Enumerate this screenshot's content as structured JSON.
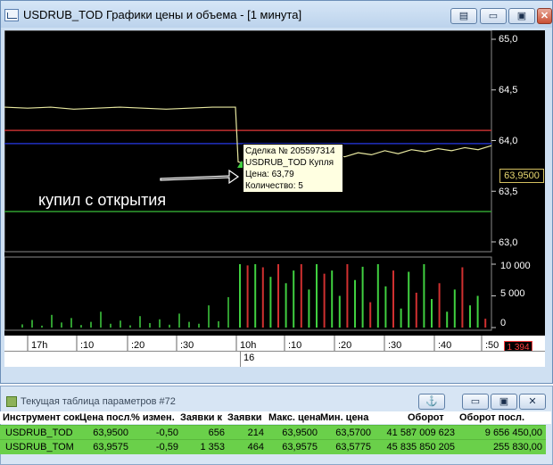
{
  "window": {
    "title": "USDRUB_TOD Графики цены и объема - [1 минута]",
    "buttons": {
      "menu": "▤",
      "minimize": "▭",
      "maximize": "▣",
      "close": "✕"
    }
  },
  "chart": {
    "y_ticks": [
      "65,0",
      "64,5",
      "64,0",
      "63,5",
      "63,0"
    ],
    "vol_ticks": [
      "10 000",
      "5 000",
      "0"
    ],
    "x_ticks": [
      "17h",
      ":10",
      ":20",
      ":30",
      "10h",
      ":10",
      ":20",
      ":30",
      ":40",
      ":50"
    ],
    "date_label": "16",
    "last_price_label": "63,9500",
    "last_volume_label": "1 394",
    "annotation": "купил с открытия",
    "tooltip": {
      "line1": "Сделка № 205597314",
      "line2": "USDRUB_TOD Купля",
      "line3": "Цена: 63,79",
      "line4": "Количество: 5"
    },
    "colors": {
      "price_line": "#e8e8a0",
      "red_level": "#c03030",
      "blue_level": "#2030c0",
      "green_level": "#30a030",
      "buy_vol": "#40d040",
      "sell_vol": "#d03030"
    }
  },
  "chart_data": {
    "type": "line",
    "title": "",
    "y_ticks": [
      65.0,
      64.5,
      64.0,
      63.5,
      63.0
    ],
    "ylim": [
      63.0,
      65.0
    ],
    "horizontal_levels": [
      64.1,
      63.97,
      63.3
    ],
    "price_series_before_open": [
      64.33,
      64.32,
      64.33,
      64.31,
      64.32,
      64.33,
      64.32,
      64.31,
      64.32,
      64.33,
      64.33
    ],
    "price_series_after_open": [
      63.79,
      63.75,
      63.78,
      63.8,
      63.82,
      63.85,
      63.83,
      63.86,
      63.84,
      63.88,
      63.86,
      63.9,
      63.87,
      63.91,
      63.89,
      63.92,
      63.9,
      63.93,
      63.91,
      63.95
    ],
    "volume_ticks": [
      10000,
      5000,
      0
    ],
    "volume_after_open": [
      {
        "v": 10000,
        "side": "buy"
      },
      {
        "v": 9800,
        "side": "sell"
      },
      {
        "v": 10000,
        "side": "buy"
      },
      {
        "v": 9500,
        "side": "sell"
      },
      {
        "v": 8000,
        "side": "buy"
      },
      {
        "v": 10000,
        "side": "sell"
      },
      {
        "v": 7000,
        "side": "buy"
      },
      {
        "v": 9000,
        "side": "buy"
      },
      {
        "v": 10000,
        "side": "sell"
      },
      {
        "v": 6000,
        "side": "buy"
      },
      {
        "v": 10000,
        "side": "buy"
      },
      {
        "v": 8500,
        "side": "sell"
      },
      {
        "v": 9000,
        "side": "buy"
      },
      {
        "v": 5000,
        "side": "buy"
      },
      {
        "v": 10000,
        "side": "sell"
      },
      {
        "v": 7500,
        "side": "buy"
      },
      {
        "v": 9600,
        "side": "buy"
      },
      {
        "v": 4000,
        "side": "sell"
      },
      {
        "v": 10000,
        "side": "buy"
      },
      {
        "v": 6500,
        "side": "buy"
      },
      {
        "v": 9000,
        "side": "sell"
      },
      {
        "v": 3000,
        "side": "buy"
      },
      {
        "v": 8800,
        "side": "buy"
      },
      {
        "v": 5500,
        "side": "sell"
      },
      {
        "v": 10000,
        "side": "buy"
      },
      {
        "v": 4500,
        "side": "buy"
      },
      {
        "v": 7000,
        "side": "sell"
      },
      {
        "v": 2500,
        "side": "buy"
      },
      {
        "v": 6000,
        "side": "buy"
      },
      {
        "v": 9500,
        "side": "sell"
      },
      {
        "v": 3500,
        "side": "buy"
      },
      {
        "v": 5000,
        "side": "buy"
      },
      {
        "v": 1394,
        "side": "sell"
      }
    ],
    "volume_before_open": [
      500,
      1200,
      300,
      2000,
      800,
      1500,
      400,
      900,
      2500,
      600,
      1100,
      350,
      1800,
      700,
      1300,
      450,
      2200,
      900,
      600,
      3500,
      1000,
      4800
    ]
  },
  "panel": {
    "title": "Текущая таблица параметров #72",
    "headers": [
      "Инструмент сок",
      "Цена посл.",
      "% измен.",
      "Заявки к",
      "Заявки",
      "Макс. цена",
      "Мин. цена",
      "Оборот",
      "Оборот посл."
    ],
    "rows": [
      [
        "USDRUB_TOD",
        "63,9500",
        "-0,50",
        "656",
        "214",
        "63,9500",
        "63,5700",
        "41 587 009 623",
        "9 656 450,00"
      ],
      [
        "USDRUB_TOM",
        "63,9575",
        "-0,59",
        "1 353",
        "464",
        "63,9575",
        "63,5775",
        "45 835 850 205",
        "255 830,00"
      ]
    ]
  }
}
